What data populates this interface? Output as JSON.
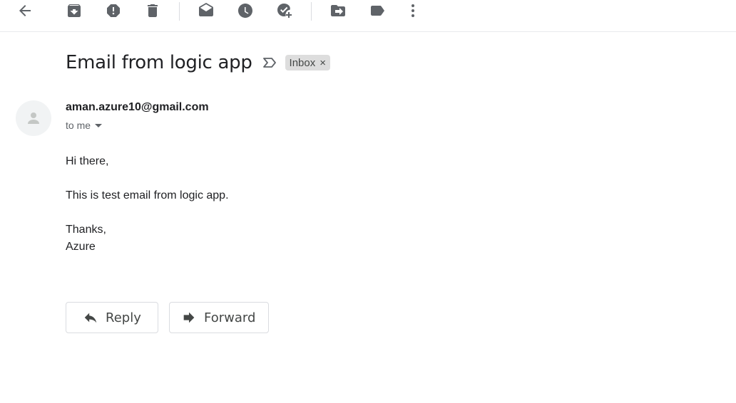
{
  "toolbar": {
    "icons": [
      "back-icon",
      "archive-icon",
      "report-spam-icon",
      "delete-icon",
      "mark-unread-icon",
      "snooze-icon",
      "add-task-icon",
      "move-to-icon",
      "labels-icon",
      "more-icon"
    ]
  },
  "email": {
    "subject": "Email from logic app",
    "label": "Inbox",
    "label_close": "×",
    "sender": "aman.azure10@gmail.com",
    "to": "to me",
    "body": {
      "greeting": "Hi there,",
      "line1": "This is test email from logic app.",
      "signoff": "Thanks,",
      "signature": "Azure"
    }
  },
  "actions": {
    "reply": "Reply",
    "forward": "Forward"
  }
}
